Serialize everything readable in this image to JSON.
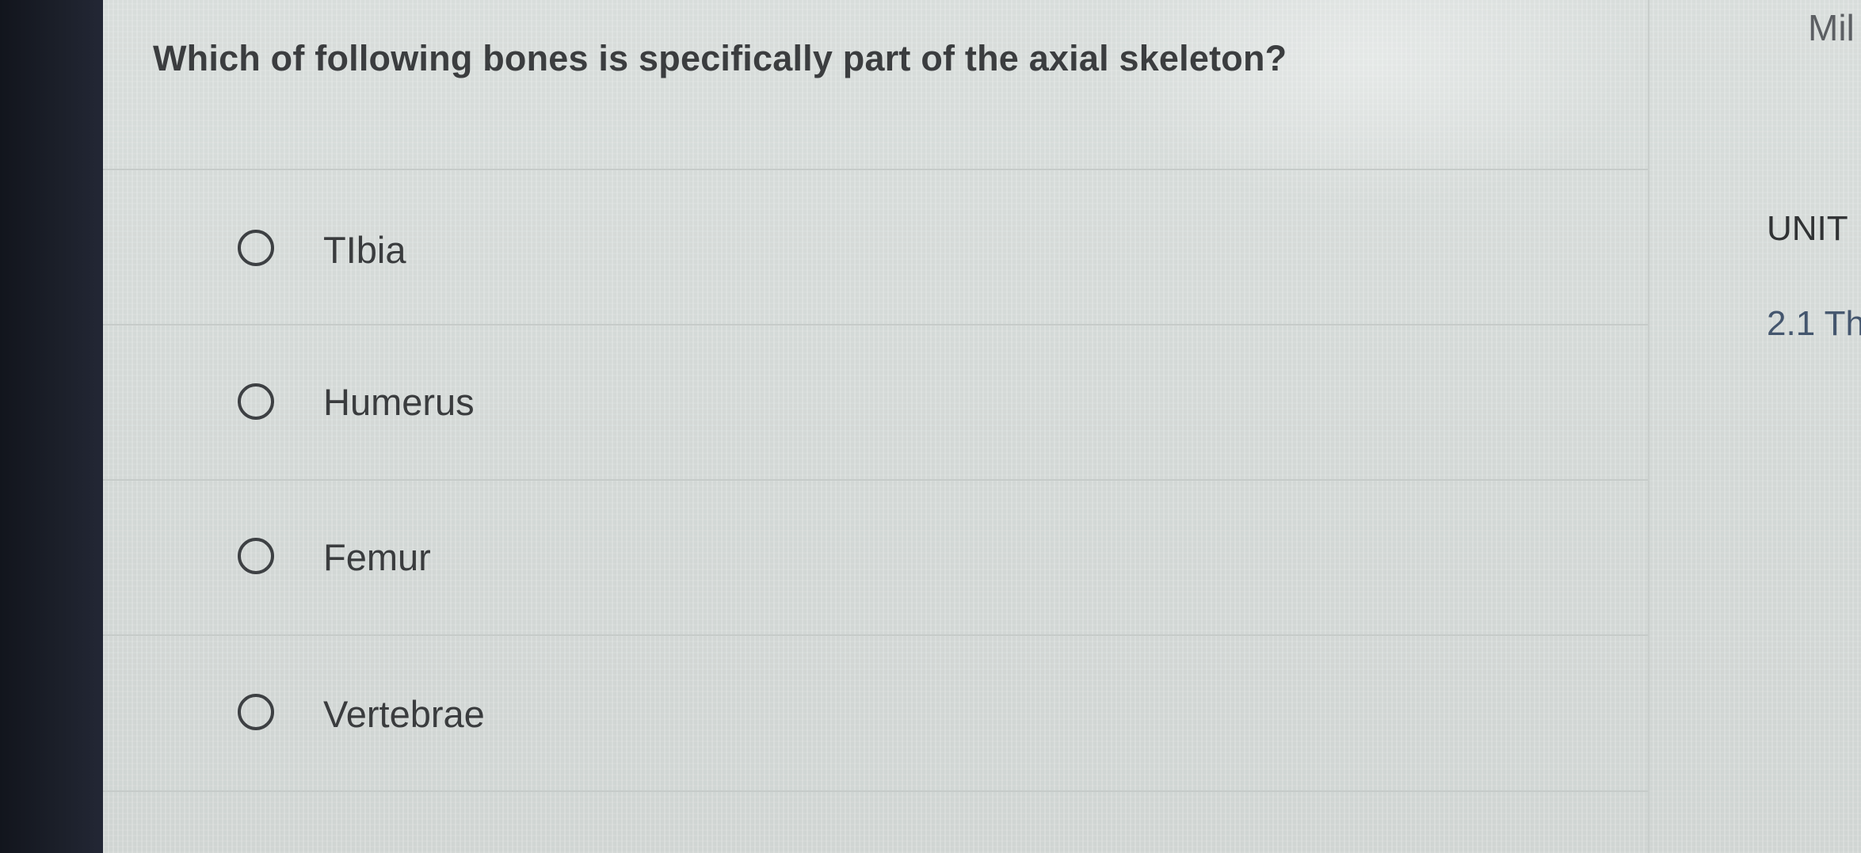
{
  "question": {
    "text": "Which of following bones is specifically part of the axial skeleton?"
  },
  "options": [
    {
      "label": "TIbia"
    },
    {
      "label": "Humerus"
    },
    {
      "label": "Femur"
    },
    {
      "label": "Vertebrae"
    }
  ],
  "right_panel": {
    "top_text": "Mil",
    "unit_text": "UNIT",
    "section_text": "2.1 Th"
  }
}
